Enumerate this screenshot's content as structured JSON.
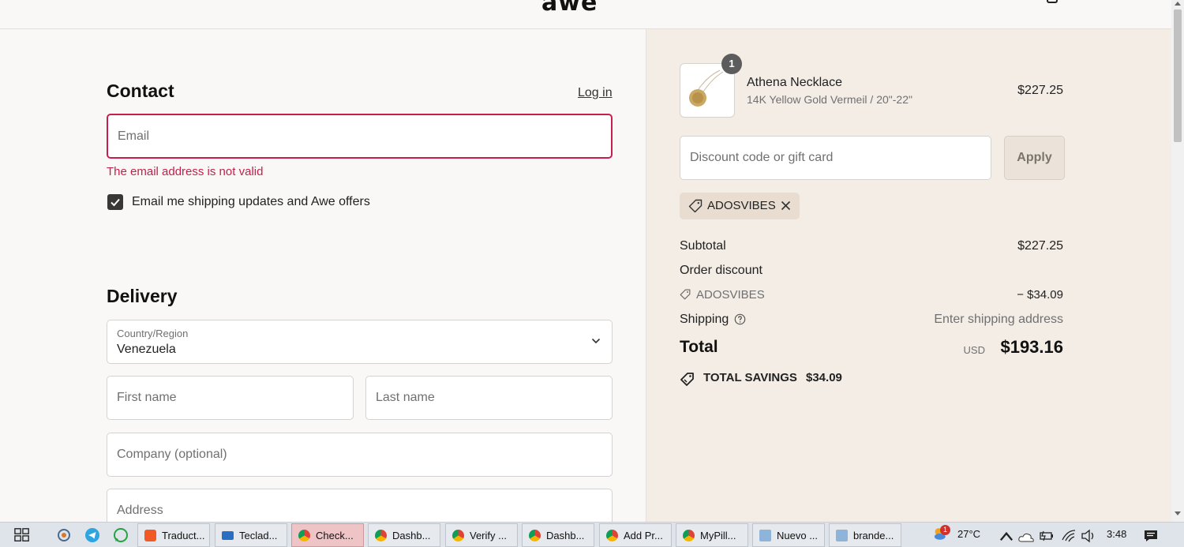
{
  "header": {
    "logo": "awe"
  },
  "contact": {
    "title": "Contact",
    "login_label": "Log in",
    "email_placeholder": "Email",
    "email_error": "The email address is not valid",
    "newsletter_label": "Email me shipping updates and Awe offers",
    "newsletter_checked": true
  },
  "delivery": {
    "title": "Delivery",
    "country_label": "Country/Region",
    "country_value": "Venezuela",
    "first_name_placeholder": "First name",
    "last_name_placeholder": "Last name",
    "company_placeholder": "Company (optional)",
    "address_placeholder": "Address"
  },
  "summary": {
    "item": {
      "quantity": "1",
      "name": "Athena Necklace",
      "variant": "14K Yellow Gold Vermeil / 20\"-22\"",
      "price": "$227.25"
    },
    "discount_placeholder": "Discount code or gift card",
    "apply_label": "Apply",
    "applied_code": "ADOSVIBES",
    "subtotal_label": "Subtotal",
    "subtotal_value": "$227.25",
    "order_discount_label": "Order discount",
    "discount_code": "ADOSVIBES",
    "discount_value": "− $34.09",
    "shipping_label": "Shipping",
    "shipping_value": "Enter shipping address",
    "total_label": "Total",
    "currency": "USD",
    "total_value": "$193.16",
    "savings_label": "TOTAL SAVINGS",
    "savings_value": "$34.09"
  },
  "taskbar": {
    "buttons": [
      {
        "label": "Traduct...",
        "icon": "brave-icon"
      },
      {
        "label": "Teclad...",
        "icon": "keyboard-icon"
      },
      {
        "label": "Check...",
        "icon": "chrome-icon",
        "active": true
      },
      {
        "label": "Dashb...",
        "icon": "chrome-icon"
      },
      {
        "label": "Verify ...",
        "icon": "chrome-icon"
      },
      {
        "label": "Dashb...",
        "icon": "chrome-icon"
      },
      {
        "label": "Add Pr...",
        "icon": "chrome-icon"
      },
      {
        "label": "MyPill...",
        "icon": "chrome-icon"
      },
      {
        "label": "Nuevo ...",
        "icon": "notepad-icon"
      },
      {
        "label": "brande...",
        "icon": "notepad-icon"
      }
    ],
    "weather_badge": "1",
    "temperature": "27°C",
    "clock": "3:48"
  },
  "colors": {
    "error": "#c4204b",
    "summary_bg": "#f3ede6",
    "page_bg": "#faf8f6",
    "active_tab": "#efc4c6"
  }
}
